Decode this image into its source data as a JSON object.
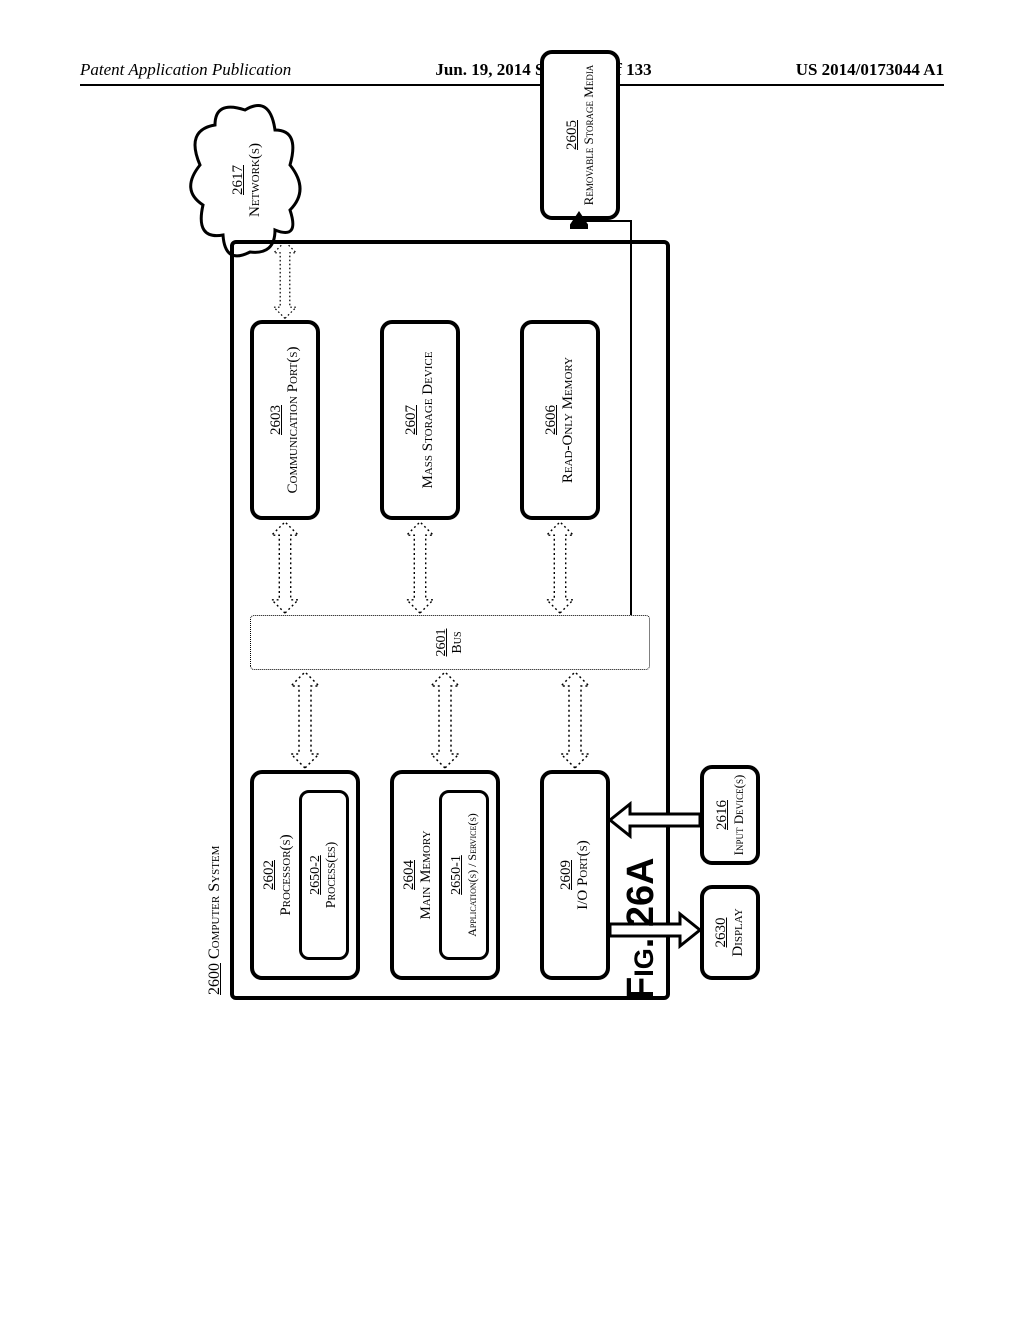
{
  "header": {
    "left": "Patent Application Publication",
    "center": "Jun. 19, 2014  Sheet 117 of 133",
    "right": "US 2014/0173044 A1"
  },
  "figure_label": "Fig. 26A",
  "system": {
    "num": "2600",
    "label": "Computer System"
  },
  "blocks": {
    "processor": {
      "num": "2602",
      "label": "Processor(s)"
    },
    "processes": {
      "num": "2650-2",
      "label": "Process(es)"
    },
    "memory": {
      "num": "2604",
      "label": "Main Memory"
    },
    "apps": {
      "num": "2650-1",
      "label": "Application(s) / Service(s)"
    },
    "ioports": {
      "num": "2609",
      "label": "I/O Port(s)"
    },
    "commport": {
      "num": "2603",
      "label": "Communication Port(s)"
    },
    "mass": {
      "num": "2607",
      "label": "Mass Storage Device"
    },
    "rom": {
      "num": "2606",
      "label": "Read-Only Memory"
    },
    "bus": {
      "num": "2601",
      "label": "Bus"
    },
    "display": {
      "num": "2630",
      "label": "Display"
    },
    "input": {
      "num": "2616",
      "label": "Input Device(s)"
    },
    "removable": {
      "num": "2605",
      "label": "Removable Storage Media"
    },
    "network": {
      "num": "2617",
      "label": "Network(s)"
    }
  }
}
